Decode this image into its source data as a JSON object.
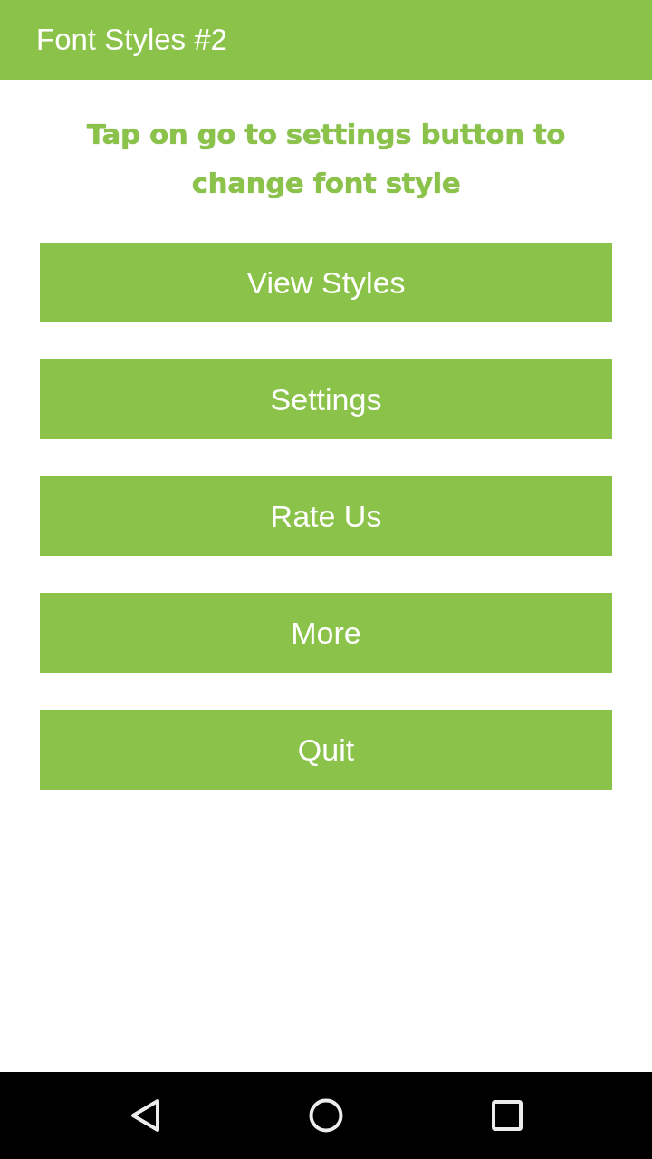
{
  "app_bar": {
    "title": "Font Styles #2"
  },
  "instruction": "Tap on go to settings button to change font style",
  "buttons": [
    "View Styles",
    "Settings",
    "Rate Us",
    "More",
    "Quit"
  ]
}
